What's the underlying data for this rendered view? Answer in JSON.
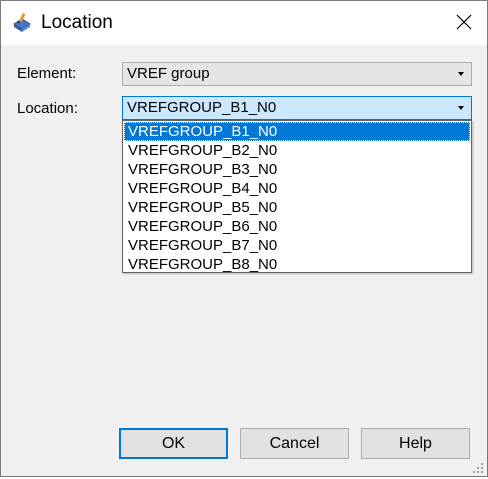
{
  "window": {
    "title": "Location",
    "icon": "location-app-icon",
    "close_icon": "close-icon"
  },
  "form": {
    "element_label": "Element:",
    "element_value": "VREF group",
    "location_label": "Location:",
    "location_value": "VREFGROUP_B1_N0"
  },
  "dropdown": {
    "options": [
      "VREFGROUP_B1_N0",
      "VREFGROUP_B2_N0",
      "VREFGROUP_B3_N0",
      "VREFGROUP_B4_N0",
      "VREFGROUP_B5_N0",
      "VREFGROUP_B6_N0",
      "VREFGROUP_B7_N0",
      "VREFGROUP_B8_N0"
    ],
    "selected_index": 0
  },
  "buttons": {
    "ok": "OK",
    "cancel": "Cancel",
    "help": "Help"
  },
  "colors": {
    "accent": "#0078d7",
    "highlight_bg": "#cce8ff",
    "dialog_bg": "#f0f0f0"
  }
}
